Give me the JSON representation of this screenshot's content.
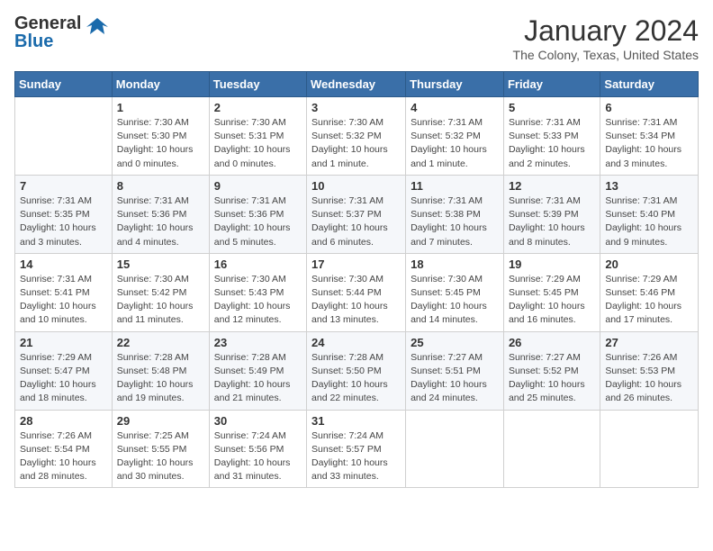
{
  "header": {
    "logo_general": "General",
    "logo_blue": "Blue",
    "month_year": "January 2024",
    "location": "The Colony, Texas, United States"
  },
  "weekdays": [
    "Sunday",
    "Monday",
    "Tuesday",
    "Wednesday",
    "Thursday",
    "Friday",
    "Saturday"
  ],
  "weeks": [
    [
      {
        "day": "",
        "info": ""
      },
      {
        "day": "1",
        "info": "Sunrise: 7:30 AM\nSunset: 5:30 PM\nDaylight: 10 hours\nand 0 minutes."
      },
      {
        "day": "2",
        "info": "Sunrise: 7:30 AM\nSunset: 5:31 PM\nDaylight: 10 hours\nand 0 minutes."
      },
      {
        "day": "3",
        "info": "Sunrise: 7:30 AM\nSunset: 5:32 PM\nDaylight: 10 hours\nand 1 minute."
      },
      {
        "day": "4",
        "info": "Sunrise: 7:31 AM\nSunset: 5:32 PM\nDaylight: 10 hours\nand 1 minute."
      },
      {
        "day": "5",
        "info": "Sunrise: 7:31 AM\nSunset: 5:33 PM\nDaylight: 10 hours\nand 2 minutes."
      },
      {
        "day": "6",
        "info": "Sunrise: 7:31 AM\nSunset: 5:34 PM\nDaylight: 10 hours\nand 3 minutes."
      }
    ],
    [
      {
        "day": "7",
        "info": "Sunrise: 7:31 AM\nSunset: 5:35 PM\nDaylight: 10 hours\nand 3 minutes."
      },
      {
        "day": "8",
        "info": "Sunrise: 7:31 AM\nSunset: 5:36 PM\nDaylight: 10 hours\nand 4 minutes."
      },
      {
        "day": "9",
        "info": "Sunrise: 7:31 AM\nSunset: 5:36 PM\nDaylight: 10 hours\nand 5 minutes."
      },
      {
        "day": "10",
        "info": "Sunrise: 7:31 AM\nSunset: 5:37 PM\nDaylight: 10 hours\nand 6 minutes."
      },
      {
        "day": "11",
        "info": "Sunrise: 7:31 AM\nSunset: 5:38 PM\nDaylight: 10 hours\nand 7 minutes."
      },
      {
        "day": "12",
        "info": "Sunrise: 7:31 AM\nSunset: 5:39 PM\nDaylight: 10 hours\nand 8 minutes."
      },
      {
        "day": "13",
        "info": "Sunrise: 7:31 AM\nSunset: 5:40 PM\nDaylight: 10 hours\nand 9 minutes."
      }
    ],
    [
      {
        "day": "14",
        "info": "Sunrise: 7:31 AM\nSunset: 5:41 PM\nDaylight: 10 hours\nand 10 minutes."
      },
      {
        "day": "15",
        "info": "Sunrise: 7:30 AM\nSunset: 5:42 PM\nDaylight: 10 hours\nand 11 minutes."
      },
      {
        "day": "16",
        "info": "Sunrise: 7:30 AM\nSunset: 5:43 PM\nDaylight: 10 hours\nand 12 minutes."
      },
      {
        "day": "17",
        "info": "Sunrise: 7:30 AM\nSunset: 5:44 PM\nDaylight: 10 hours\nand 13 minutes."
      },
      {
        "day": "18",
        "info": "Sunrise: 7:30 AM\nSunset: 5:45 PM\nDaylight: 10 hours\nand 14 minutes."
      },
      {
        "day": "19",
        "info": "Sunrise: 7:29 AM\nSunset: 5:45 PM\nDaylight: 10 hours\nand 16 minutes."
      },
      {
        "day": "20",
        "info": "Sunrise: 7:29 AM\nSunset: 5:46 PM\nDaylight: 10 hours\nand 17 minutes."
      }
    ],
    [
      {
        "day": "21",
        "info": "Sunrise: 7:29 AM\nSunset: 5:47 PM\nDaylight: 10 hours\nand 18 minutes."
      },
      {
        "day": "22",
        "info": "Sunrise: 7:28 AM\nSunset: 5:48 PM\nDaylight: 10 hours\nand 19 minutes."
      },
      {
        "day": "23",
        "info": "Sunrise: 7:28 AM\nSunset: 5:49 PM\nDaylight: 10 hours\nand 21 minutes."
      },
      {
        "day": "24",
        "info": "Sunrise: 7:28 AM\nSunset: 5:50 PM\nDaylight: 10 hours\nand 22 minutes."
      },
      {
        "day": "25",
        "info": "Sunrise: 7:27 AM\nSunset: 5:51 PM\nDaylight: 10 hours\nand 24 minutes."
      },
      {
        "day": "26",
        "info": "Sunrise: 7:27 AM\nSunset: 5:52 PM\nDaylight: 10 hours\nand 25 minutes."
      },
      {
        "day": "27",
        "info": "Sunrise: 7:26 AM\nSunset: 5:53 PM\nDaylight: 10 hours\nand 26 minutes."
      }
    ],
    [
      {
        "day": "28",
        "info": "Sunrise: 7:26 AM\nSunset: 5:54 PM\nDaylight: 10 hours\nand 28 minutes."
      },
      {
        "day": "29",
        "info": "Sunrise: 7:25 AM\nSunset: 5:55 PM\nDaylight: 10 hours\nand 30 minutes."
      },
      {
        "day": "30",
        "info": "Sunrise: 7:24 AM\nSunset: 5:56 PM\nDaylight: 10 hours\nand 31 minutes."
      },
      {
        "day": "31",
        "info": "Sunrise: 7:24 AM\nSunset: 5:57 PM\nDaylight: 10 hours\nand 33 minutes."
      },
      {
        "day": "",
        "info": ""
      },
      {
        "day": "",
        "info": ""
      },
      {
        "day": "",
        "info": ""
      }
    ]
  ]
}
